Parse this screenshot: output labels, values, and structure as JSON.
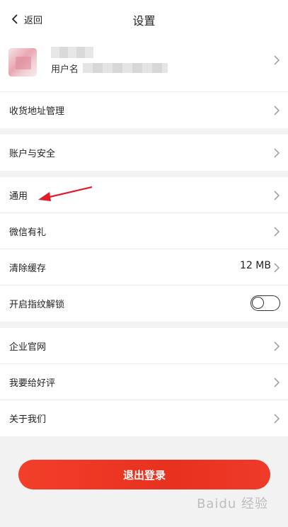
{
  "header": {
    "back_label": "返回",
    "title": "设置"
  },
  "profile": {
    "username_label": "用户名"
  },
  "rows": {
    "address": {
      "label": "收货地址管理"
    },
    "account": {
      "label": "账户与安全"
    },
    "general": {
      "label": "通用"
    },
    "wechat": {
      "label": "微信有礼"
    },
    "cache": {
      "label": "清除缓存",
      "value": "12 MB"
    },
    "fingerprint": {
      "label": "开启指纹解锁",
      "enabled": false
    },
    "website": {
      "label": "企业官网"
    },
    "review": {
      "label": "我要给好评"
    },
    "about": {
      "label": "关于我们"
    }
  },
  "logout": {
    "label": "退出登录"
  },
  "watermark": {
    "text": "Baidu 经验"
  },
  "colors": {
    "accent": "#eb3422",
    "annotation_arrow": "#e41c2a",
    "background": "#f2f2f2"
  },
  "icons": {
    "back": "chevron-left-icon",
    "row_arrow": "chevron-right-icon"
  }
}
